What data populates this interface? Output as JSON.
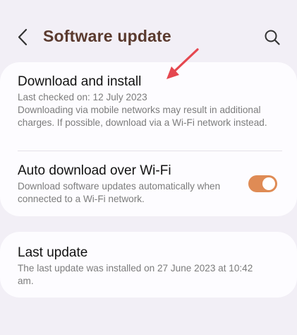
{
  "header": {
    "title": "Software update",
    "back_icon": "chevron-left-icon",
    "search_icon": "search-icon"
  },
  "download_install": {
    "title": "Download and install",
    "last_checked": "Last checked on: 12 July 2023",
    "note": "Downloading via mobile networks may result in additional charges. If possible, download via a Wi-Fi network instead."
  },
  "auto_download": {
    "title": "Auto download over Wi-Fi",
    "description": "Download software updates automatically when connected to a Wi-Fi network.",
    "enabled": true
  },
  "last_update": {
    "title": "Last update",
    "description": "The last update was installed on 27 June 2023 at 10:42 am."
  },
  "colors": {
    "accent": "#df8b55",
    "title_text": "#5a3a2e",
    "annotation_arrow": "#e5474f",
    "background": "#f2eff6",
    "card": "#fdfcff"
  }
}
